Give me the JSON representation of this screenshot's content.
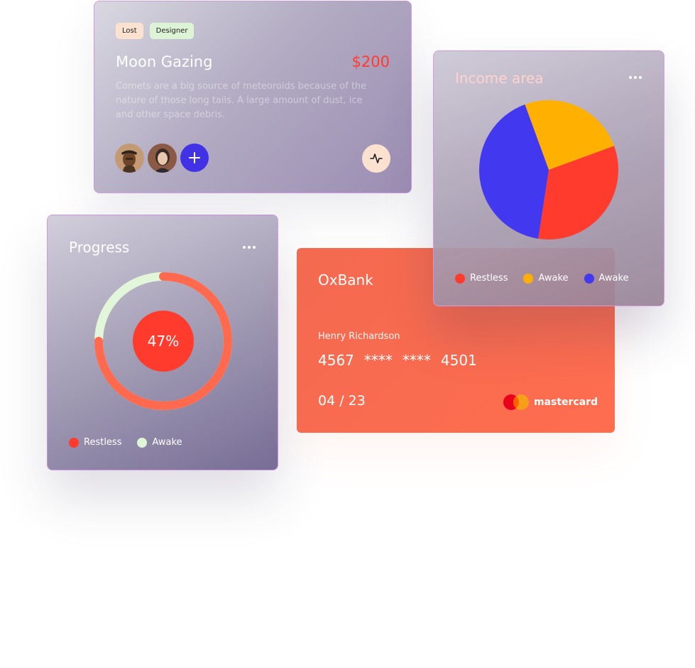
{
  "moon_card": {
    "tags": [
      "Lost",
      "Designer"
    ],
    "title": "Moon Gazing",
    "price": "$200",
    "description": "Comets are a big source of meteoroids because of the nature of those long tails. A large amount of dust, ice and other space debris.",
    "add_symbol": "+",
    "icons": {
      "add": "plus-icon",
      "activity": "activity-icon"
    }
  },
  "progress_card": {
    "title": "Progress",
    "value_label": "47%",
    "legend": [
      {
        "label": "Restless",
        "color": "#ff3b2e"
      },
      {
        "label": "Awake",
        "color": "#def5d6"
      }
    ],
    "colors": {
      "track": "#e2f6da",
      "arc": "#ff6a4f",
      "center": "#ff3b2e"
    }
  },
  "bank_card": {
    "bank": "OxBank",
    "holder": "Henry Richardson",
    "number": [
      "4567",
      "****",
      "****",
      "4501"
    ],
    "expiry": "04 / 23",
    "network": "mastercard",
    "colors": {
      "background": "#ff6d4f",
      "mc_red": "#eb001b",
      "mc_orange": "#f79e1b"
    }
  },
  "income_card": {
    "title": "Income area",
    "legend": [
      {
        "label": "Restless",
        "color": "#ff3b2e"
      },
      {
        "label": "Awake",
        "color": "#ffb000"
      },
      {
        "label": "Awake",
        "color": "#4238ef"
      }
    ]
  },
  "chart_data": [
    {
      "type": "pie",
      "title": "Income area",
      "labels": [
        "Awake",
        "Restless",
        "Awake"
      ],
      "values": [
        25,
        33,
        42
      ],
      "colors": [
        "#ffb000",
        "#ff3b2e",
        "#4238ef"
      ]
    },
    {
      "type": "donut",
      "title": "Progress",
      "labels": [
        "Restless",
        "Awake"
      ],
      "values": [
        75,
        25
      ],
      "center_label": "47%",
      "colors": [
        "#ff6a4f",
        "#e2f6da"
      ]
    }
  ]
}
